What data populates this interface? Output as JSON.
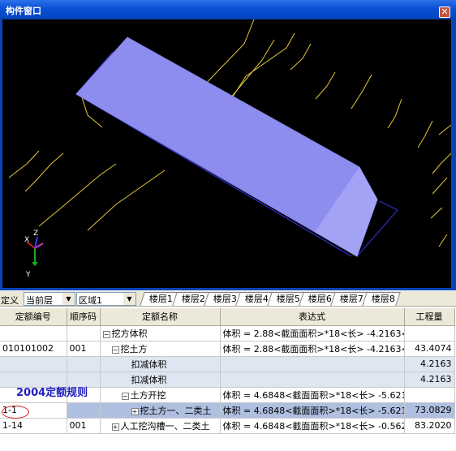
{
  "window": {
    "title": "构件窗口",
    "close_glyph": "✕"
  },
  "axis": {
    "x": "X",
    "y": "Y",
    "z": "Z"
  },
  "toolbar": {
    "label": "定义",
    "layer_select": "当前层",
    "area_select": "区域1",
    "floor_tabs": [
      "楼层1",
      "楼层2",
      "楼层3",
      "楼层4",
      "楼层5",
      "楼层6",
      "楼层7",
      "楼层8"
    ]
  },
  "table": {
    "columns": [
      "定额编号",
      "顺序码",
      "定额名称",
      "表达式",
      "工程量"
    ],
    "rows": [
      {
        "code": "",
        "seq": "",
        "name": "挖方体积",
        "tree": "⊟",
        "expr": "体积 = 2.88<截面面积>*18<长> -4.2163<",
        "qty": ""
      },
      {
        "code": "010101002",
        "seq": "001",
        "name": "挖土方",
        "tree": "⊟",
        "expr": "体积 = 2.88<截面面积>*18<长> -4.2163<",
        "qty": "43.4074"
      },
      {
        "code": "",
        "seq": "",
        "name": "扣减体积",
        "tree": "",
        "expr": "",
        "qty": "4.2163"
      },
      {
        "code": "",
        "seq": "",
        "name": "扣减体积",
        "tree": "",
        "expr": "",
        "qty": "4.2163"
      },
      {
        "code": "",
        "seq": "",
        "name": "土方开挖",
        "tree": "⊟",
        "expr": "体积 = 4.6848<截面面积>*18<长> -5.621",
        "qty": ""
      },
      {
        "code": "1-1",
        "seq": "",
        "name": "挖土方一、二类土",
        "tree": "⊞",
        "expr": "体积 = 4.6848<截面面积>*18<长> -5.621",
        "qty": "73.0829"
      },
      {
        "code": "1-14",
        "seq": "001",
        "name": "人工挖沟槽一、二类土",
        "tree": "⊞",
        "expr": "体积 = 4.6848<截面面积>*18<长> -0.562",
        "qty": "83.2020"
      }
    ]
  },
  "watermark": "2004定额规则"
}
